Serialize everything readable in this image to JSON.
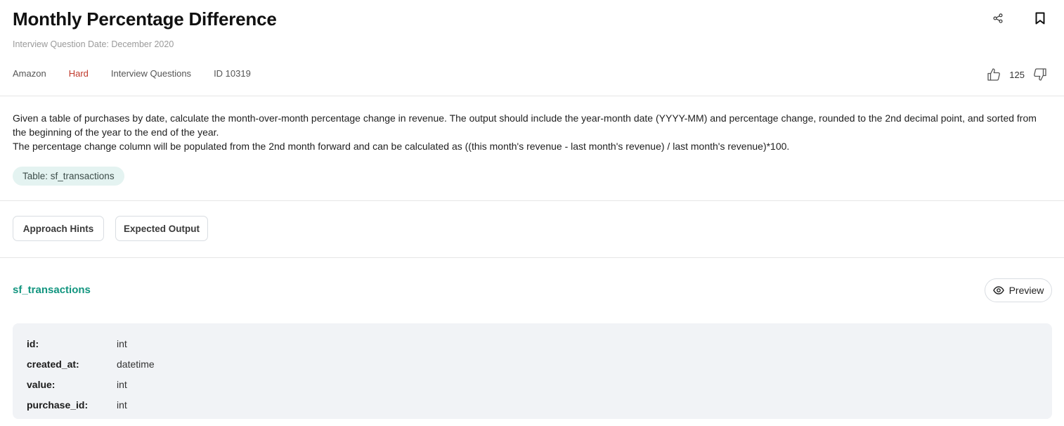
{
  "header": {
    "title": "Monthly Percentage Difference",
    "date": "Interview Question Date: December 2020"
  },
  "meta": {
    "company": "Amazon",
    "difficulty": "Hard",
    "category": "Interview Questions",
    "id": "ID 10319"
  },
  "votes": {
    "count": "125"
  },
  "description": {
    "p1": "Given a table of purchases by date, calculate the month-over-month percentage change in revenue. The output should include the year-month date (YYYY-MM) and percentage change, rounded to the 2nd decimal point, and sorted from the beginning of the year to the end of the year.",
    "p2": "The percentage change column will be populated from the 2nd month forward and can be calculated as ((this month's revenue - last month's revenue) / last month's revenue)*100."
  },
  "table_chip": "Table: sf_transactions",
  "buttons": {
    "hints": "Approach Hints",
    "output": "Expected Output"
  },
  "schema": {
    "table_name": "sf_transactions",
    "preview_label": "Preview",
    "columns": [
      {
        "name": "id:",
        "type": "int"
      },
      {
        "name": "created_at:",
        "type": "datetime"
      },
      {
        "name": "value:",
        "type": "int"
      },
      {
        "name": "purchase_id:",
        "type": "int"
      }
    ]
  },
  "icons": {
    "share": "share-icon",
    "bookmark": "bookmark-icon",
    "like": "thumbs-up-icon",
    "dislike": "thumbs-down-icon",
    "preview": "eye-icon"
  },
  "colors": {
    "accent": "#12957f",
    "difficulty_hard": "#c0392b",
    "chip_bg": "#e4f3f1",
    "schema_bg": "#f1f3f6"
  }
}
